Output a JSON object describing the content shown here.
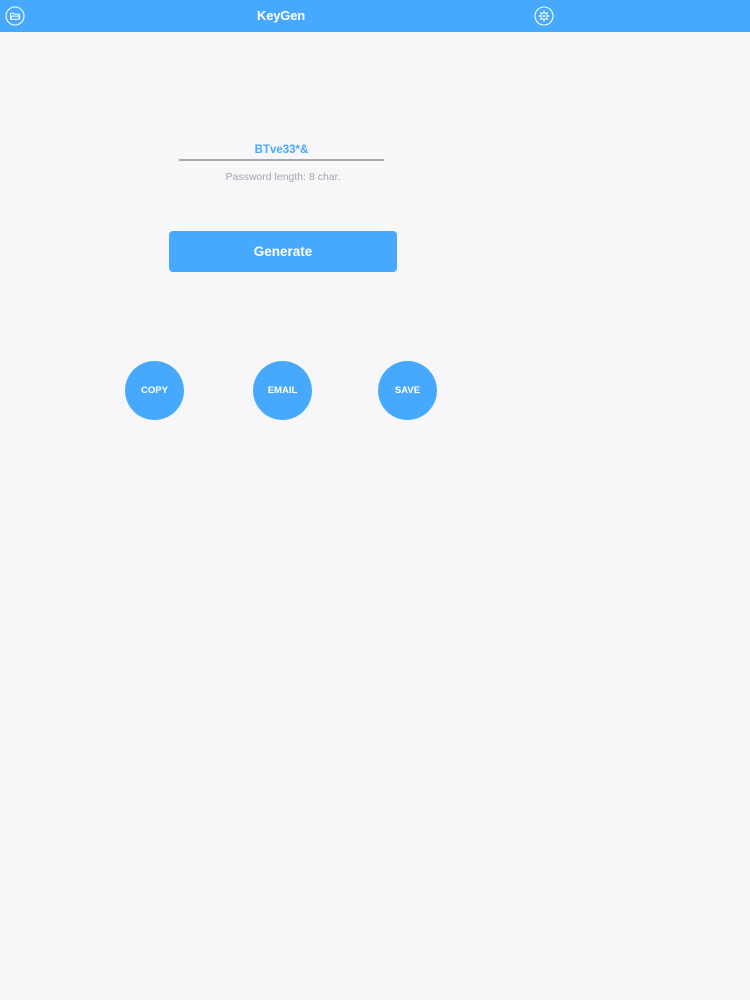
{
  "navbar": {
    "title": "KeyGen",
    "left_icon": "folder-icon",
    "right_icon": "gear-icon",
    "color": "#47a9fd"
  },
  "password": {
    "value": "BTve33*&",
    "length_label": "Password length: 8 char."
  },
  "generate_label": "Generate",
  "actions": {
    "copy_label": "COPY",
    "email_label": "EMAIL",
    "save_label": "SAVE"
  },
  "colors": {
    "accent": "#47a9fd",
    "background": "#f7f7f9",
    "muted_text": "#a3a5a9"
  }
}
